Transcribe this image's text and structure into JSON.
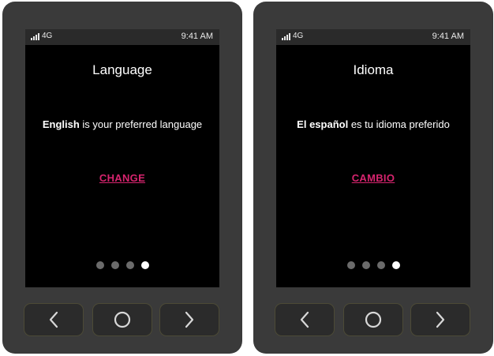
{
  "devices": [
    {
      "status": {
        "network": "4G",
        "time": "9:41 AM"
      },
      "title": "Language",
      "message": {
        "bold": "English",
        "rest": " is your preferred language"
      },
      "action_label": "CHANGE",
      "pagination": {
        "total": 4,
        "current": 4
      }
    },
    {
      "status": {
        "network": "4G",
        "time": "9:41 AM"
      },
      "title": "Idioma",
      "message": {
        "bold": "El español",
        "rest": " es tu idioma preferido"
      },
      "action_label": "CAMBIO",
      "pagination": {
        "total": 4,
        "current": 4
      }
    }
  ],
  "nav_buttons": [
    "chevron-left-icon",
    "circle-home-icon",
    "chevron-right-icon"
  ],
  "colors": {
    "accent": "#d6246e",
    "screen_bg": "#000000",
    "device_bg": "#3a3a3a"
  }
}
